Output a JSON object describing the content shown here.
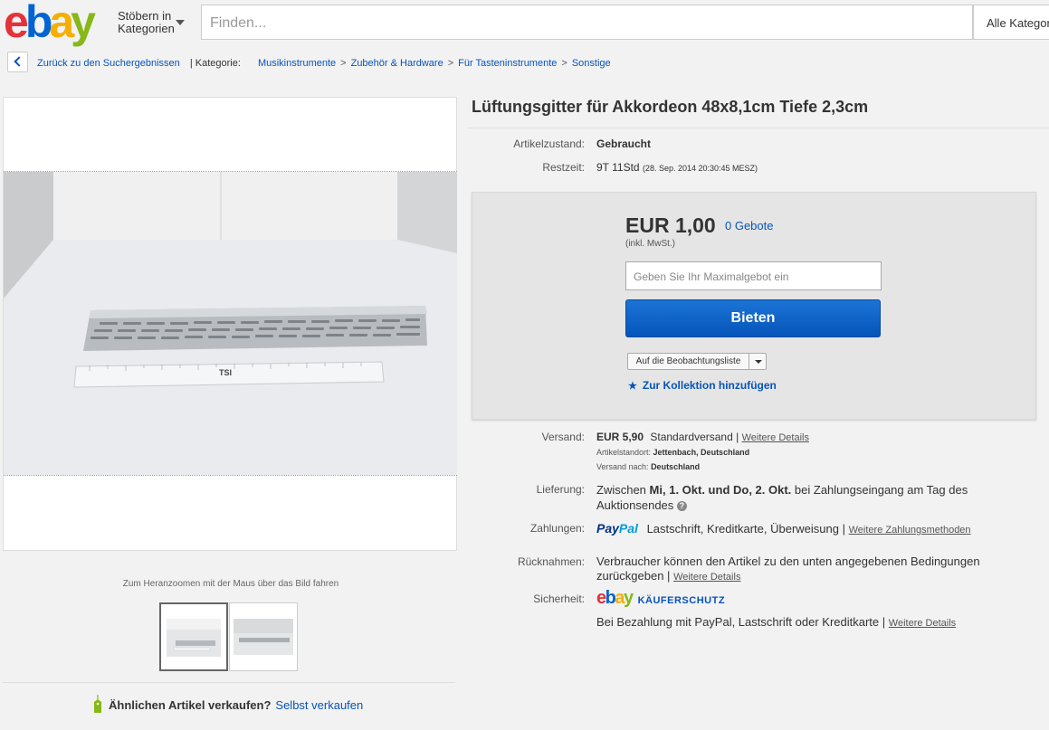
{
  "header": {
    "logo": [
      "e",
      "b",
      "a",
      "y"
    ],
    "logo_colors": [
      "#e53238",
      "#0064d2",
      "#f5af02",
      "#86b817"
    ],
    "browse_line1": "Stöbern in",
    "browse_line2": "Kategorien",
    "search_placeholder": "Finden...",
    "category_select": "Alle Kategorien"
  },
  "breadcrumb": {
    "back_link": "Zurück zu den Suchergebnissen",
    "category_label": "| Kategorie:",
    "items": [
      "Musikinstrumente",
      "Zubehör & Hardware",
      "Für Tasteninstrumente",
      "Sonstige"
    ],
    "separator": ">"
  },
  "gallery": {
    "zoom_hint": "Zum Heranzoomen mit der Maus über das Bild fahren",
    "ruler_text": "TSI",
    "thumbnail_count": 2
  },
  "sell": {
    "question": "Ähnlichen Artikel verkaufen?",
    "link": "Selbst verkaufen"
  },
  "item": {
    "title": "Lüftungsgitter für Akkordeon 48x8,1cm Tiefe 2,3cm",
    "condition_label": "Artikelzustand:",
    "condition": "Gebraucht",
    "time_label": "Restzeit:",
    "time_left": "9T 11Std",
    "end_date": "(28. Sep. 2014   20:30:45 MESZ)"
  },
  "bid": {
    "price": "EUR 1,00",
    "bids": "0 Gebote",
    "vat": "(inkl. MwSt.)",
    "max_bid_placeholder": "Geben Sie Ihr Maximalgebot ein",
    "bid_button": "Bieten",
    "watchlist": "Auf die Beobachtungsliste",
    "collection": "Zur Kollektion hinzufügen"
  },
  "shipping": {
    "label": "Versand:",
    "cost": "EUR 5,90",
    "method": "Standardversand |",
    "details_link": "Weitere Details",
    "location_label": "Artikelstandort:",
    "location": "Jettenbach, Deutschland",
    "ships_to_label": "Versand nach:",
    "ships_to": "Deutschland"
  },
  "delivery": {
    "label": "Lieferung:",
    "prefix": "Zwischen",
    "dates": "Mi, 1. Okt. und Do, 2. Okt.",
    "suffix": "bei Zahlungseingang am Tag des",
    "line2": "Auktionsendes"
  },
  "payments": {
    "label": "Zahlungen:",
    "paypal_1": "Pay",
    "paypal_2": "Pal",
    "methods": "Lastschrift,  Kreditkarte,  Überweisung  |",
    "more_link": "Weitere Zahlungsmethoden"
  },
  "returns": {
    "label": "Rücknahmen:",
    "line1": "Verbraucher können den Artikel zu den unten angegebenen Bedingungen",
    "line2": "zurückgeben |",
    "link": "Weitere Details"
  },
  "security": {
    "label": "Sicherheit:",
    "badge": "KÄUFERSCHUTZ",
    "text": "Bei Bezahlung mit PayPal, Lastschrift oder Kreditkarte |",
    "link": "Weitere Details"
  }
}
